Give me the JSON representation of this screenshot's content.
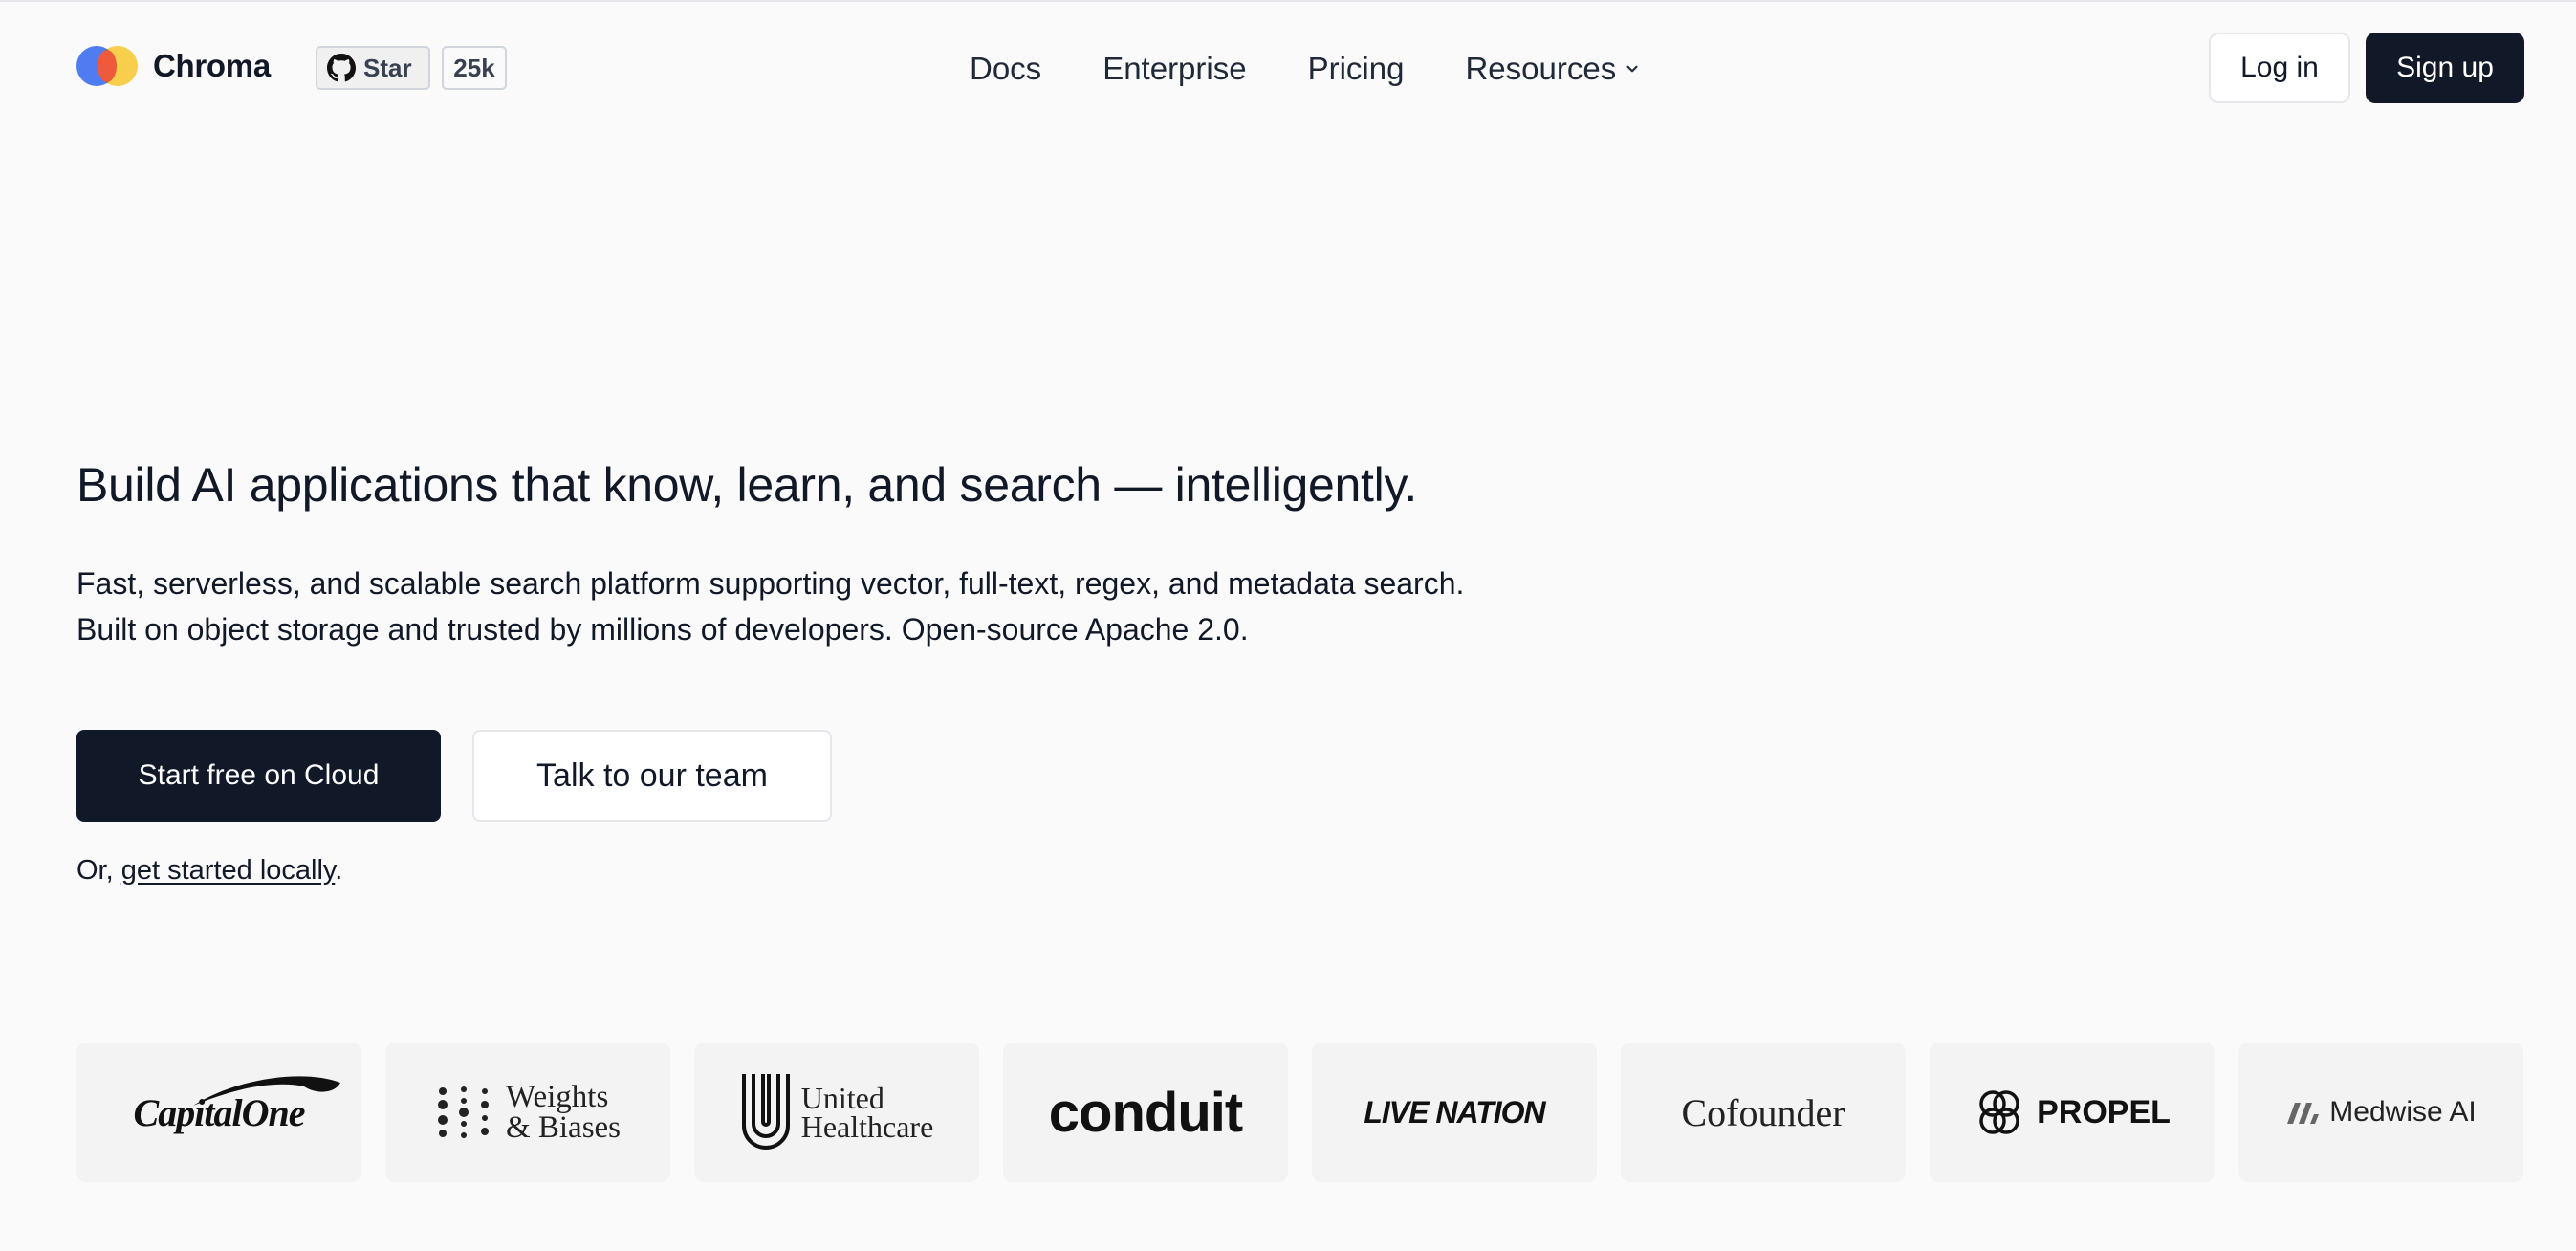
{
  "header": {
    "brand_name": "Chroma",
    "github_star_label": "Star",
    "github_star_count": "25k",
    "nav": [
      "Docs",
      "Enterprise",
      "Pricing",
      "Resources"
    ],
    "login_label": "Log in",
    "signup_label": "Sign up"
  },
  "hero": {
    "title": "Build AI applications that know, learn, and search — intelligently.",
    "subtitle_line1": "Fast, serverless, and scalable search platform supporting vector, full-text, regex, and metadata search.",
    "subtitle_line2": "Built on object storage and trusted by millions of developers. Open-source Apache 2.0.",
    "primary_cta": "Start free on Cloud",
    "secondary_cta": "Talk to our team",
    "local_prefix": "Or, ",
    "local_link": "get started locally",
    "local_suffix": "."
  },
  "logos": {
    "capital_one": "CapitalOne",
    "weights_biases_1": "Weights",
    "weights_biases_2": "& Biases",
    "united_1": "United",
    "united_2": "Healthcare",
    "conduit": "conduit",
    "live_nation": "LIVE NATION",
    "cofounder": "Cofounder",
    "propel": "PROPEL",
    "medwise": "Medwise AI"
  },
  "colors": {
    "background": "#fafafa",
    "primary_button": "#111827",
    "logo_card": "#f3f3f3"
  }
}
